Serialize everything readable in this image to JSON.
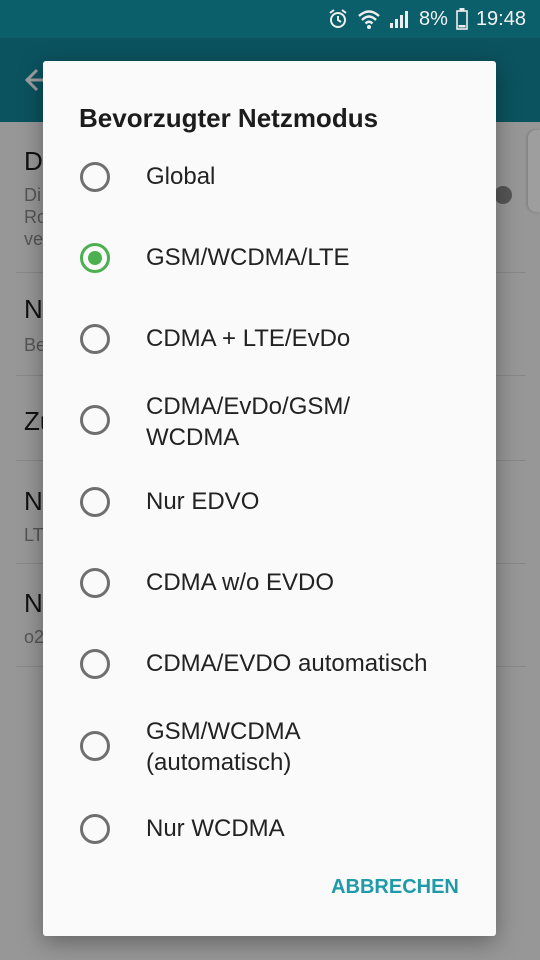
{
  "status_bar": {
    "battery": "8%",
    "time": "19:48"
  },
  "background": {
    "items": [
      {
        "title": "D",
        "sub": [
          "Di",
          "Ro",
          "ve"
        ]
      },
      {
        "title": "N",
        "sub": [
          "Be"
        ]
      },
      {
        "title": "Zu",
        "sub": []
      },
      {
        "title": "N",
        "sub": [
          "LT"
        ]
      },
      {
        "title": "N",
        "sub": [
          "o2"
        ]
      }
    ]
  },
  "dialog": {
    "title": "Bevorzugter Netzmodus",
    "options": [
      {
        "label": "Global",
        "checked": false
      },
      {
        "label": "GSM/WCDMA/LTE",
        "checked": true
      },
      {
        "label": "CDMA + LTE/EvDo",
        "checked": false
      },
      {
        "label": "CDMA/EvDo/GSM/ WCDMA",
        "checked": false
      },
      {
        "label": "Nur EDVO",
        "checked": false
      },
      {
        "label": "CDMA w/o EVDO",
        "checked": false
      },
      {
        "label": "CDMA/EVDO automatisch",
        "checked": false
      },
      {
        "label": "GSM/WCDMA (automatisch)",
        "checked": false
      },
      {
        "label": "Nur WCDMA",
        "checked": false
      }
    ],
    "cancel_label": "ABBRECHEN"
  },
  "colors": {
    "accent": "#4caf50",
    "button": "#1e9aa8",
    "appbar": "#13869a",
    "statusbar": "#0a5f6b"
  }
}
